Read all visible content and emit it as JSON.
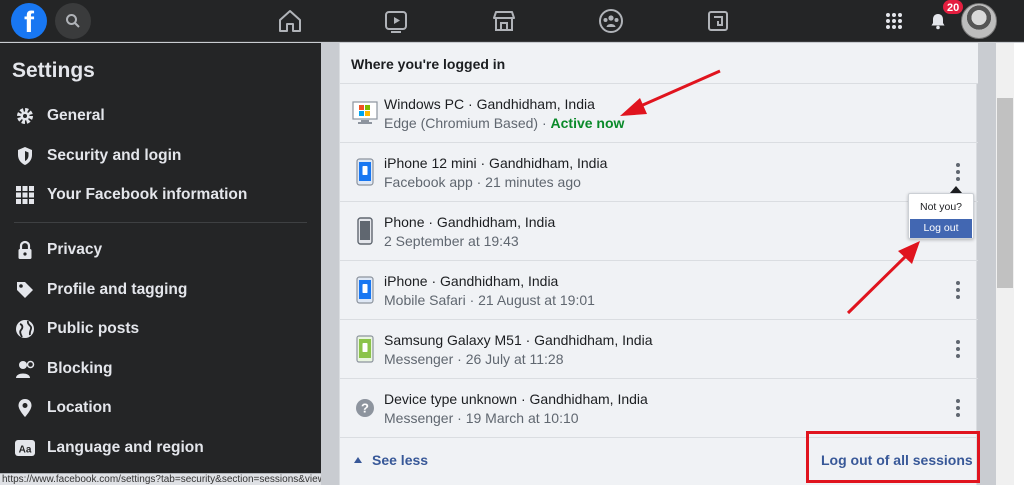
{
  "topbar": {
    "logo_letter": "f",
    "notifications_count": "20",
    "nav_icons": [
      "home-icon",
      "watch-icon",
      "marketplace-icon",
      "groups-icon",
      "gaming-icon"
    ]
  },
  "sidebar": {
    "title": "Settings",
    "items": [
      {
        "label": "General",
        "icon": "gear-icon"
      },
      {
        "label": "Security and login",
        "icon": "shield-icon"
      },
      {
        "label": "Your Facebook information",
        "icon": "grid-icon"
      },
      {
        "label": "Privacy",
        "icon": "lock-icon"
      },
      {
        "label": "Profile and tagging",
        "icon": "tag-icon"
      },
      {
        "label": "Public posts",
        "icon": "globe-icon"
      },
      {
        "label": "Blocking",
        "icon": "user-block-icon"
      },
      {
        "label": "Location",
        "icon": "location-pin-icon"
      },
      {
        "label": "Language and region",
        "icon": "language-icon"
      }
    ]
  },
  "status_bar": {
    "url": "https://www.facebook.com/settings?tab=security&section=sessions&view#"
  },
  "panel": {
    "header": "Where you're logged in",
    "sessions": [
      {
        "device": "Windows PC · Gandhidham, India",
        "detail": "Edge (Chromium Based) · ",
        "active": "Active now",
        "icon": "windows-pc-icon"
      },
      {
        "device": "iPhone 12 mini · Gandhidham, India",
        "detail": "Facebook app · 21 minutes ago",
        "icon": "iphone-icon"
      },
      {
        "device": "Phone · Gandhidham, India",
        "detail": "2 September at 19:43",
        "icon": "phone-icon"
      },
      {
        "device": "iPhone · Gandhidham, India",
        "detail": "Mobile Safari · 21 August at 19:01",
        "icon": "iphone-icon"
      },
      {
        "device": "Samsung Galaxy M51 · Gandhidham, India",
        "detail": "Messenger · 26 July at 11:28",
        "icon": "android-icon"
      },
      {
        "device": "Device type unknown · Gandhidham, India",
        "detail": "Messenger · 19 March at 10:10",
        "icon": "question-icon"
      }
    ],
    "popover": {
      "not_you": "Not you?",
      "log_out": "Log out"
    },
    "see_less": "See less",
    "log_out_all": "Log out of all sessions"
  },
  "colors": {
    "fb_blue": "#1877f2",
    "link_blue": "#385898",
    "active_green": "#0a8a2a",
    "annotation_red": "#e0141e",
    "dark_bg": "#242526"
  }
}
